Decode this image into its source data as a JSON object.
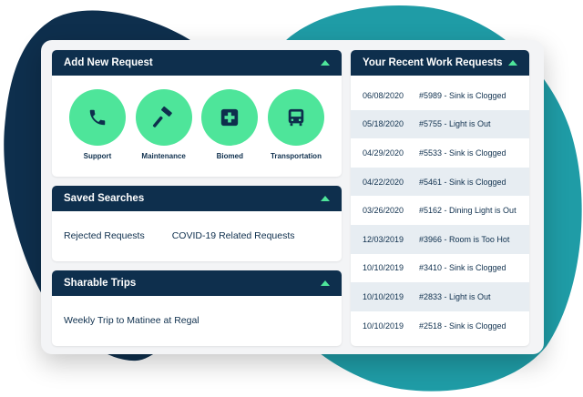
{
  "colors": {
    "navy": "#0e2f4d",
    "accent": "#4ee59a",
    "teal": "#1f9ca6",
    "row_alt": "#e7edf2"
  },
  "add_request": {
    "title": "Add New Request",
    "items": [
      {
        "label": "Support",
        "icon": "phone-icon"
      },
      {
        "label": "Maintenance",
        "icon": "hammer-icon"
      },
      {
        "label": "Biomed",
        "icon": "medical-cross-icon"
      },
      {
        "label": "Transportation",
        "icon": "bus-icon"
      }
    ]
  },
  "saved_searches": {
    "title": "Saved Searches",
    "items": [
      "Rejected Requests",
      "COVID-19 Related Requests"
    ]
  },
  "sharable_trips": {
    "title": "Sharable Trips",
    "items": [
      "Weekly Trip to Matinee at Regal"
    ]
  },
  "work_requests": {
    "title": "Your Recent Work Requests",
    "rows": [
      {
        "date": "06/08/2020",
        "title": "#5989 - Sink is Clogged"
      },
      {
        "date": "05/18/2020",
        "title": "#5755 - Light is Out"
      },
      {
        "date": "04/29/2020",
        "title": "#5533 - Sink is Clogged"
      },
      {
        "date": "04/22/2020",
        "title": "#5461 - Sink is Clogged"
      },
      {
        "date": "03/26/2020",
        "title": "#5162 - Dining Light is Out"
      },
      {
        "date": "12/03/2019",
        "title": "#3966 - Room is Too Hot"
      },
      {
        "date": "10/10/2019",
        "title": "#3410 - Sink is Clogged"
      },
      {
        "date": "10/10/2019",
        "title": "#2833 - Light is Out"
      },
      {
        "date": "10/10/2019",
        "title": "#2518 - Sink is Clogged"
      }
    ]
  }
}
